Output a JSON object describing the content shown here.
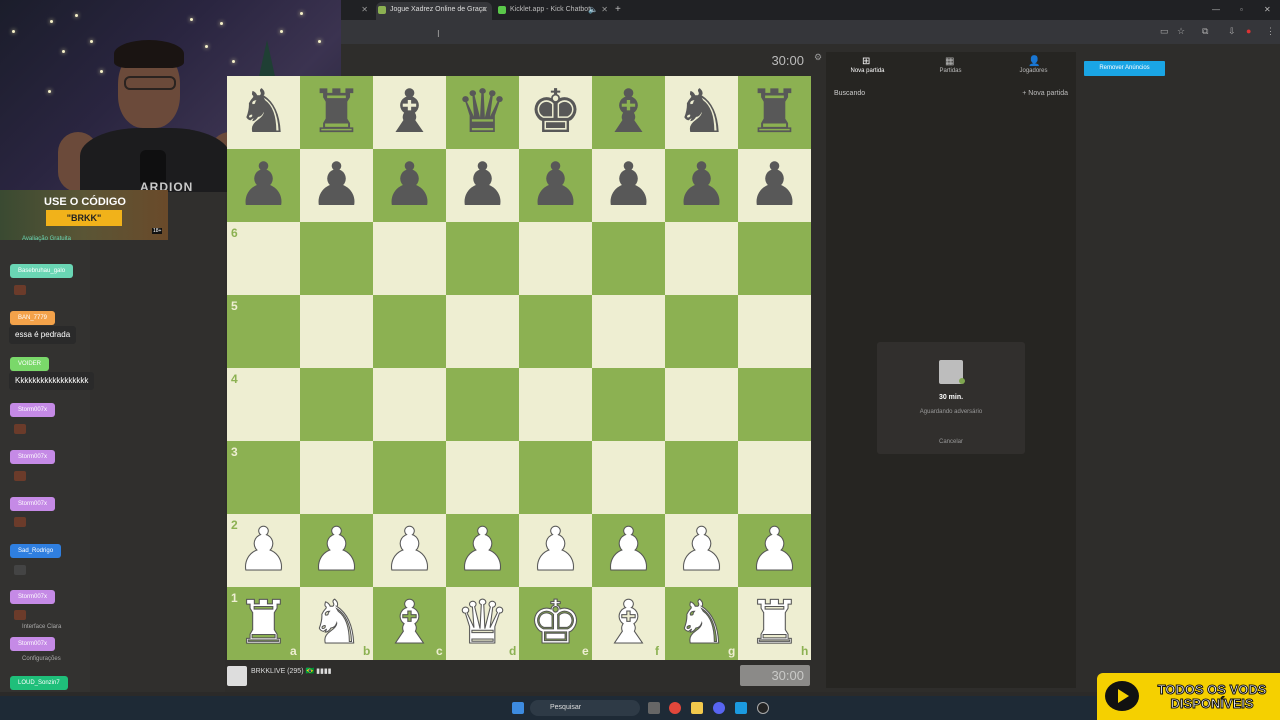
{
  "browser": {
    "tabs": [
      {
        "label": "Jogue Xadrez Online de Graça",
        "active": true
      },
      {
        "label": "Kicklet.app - Kick Chatbot",
        "active": false
      }
    ],
    "cursor_glyph": "I"
  },
  "webcam": {
    "shirt_text": "ARDION",
    "promo_line1": "USE O CÓDIGO",
    "promo_code": "\"BRKK\"",
    "promo_badge": "18+",
    "side_text": "Avaliação Gratuita"
  },
  "chat": [
    {
      "name": "Basebruhau_galo",
      "color": "#6ad6b4",
      "message": ""
    },
    {
      "name": "BAN_7779",
      "color": "#f3a24a",
      "message": "essa é pedrada"
    },
    {
      "name": "VOIDER",
      "color": "#7ad86a",
      "message": "Kkkkkkkkkkkkkkkkkk"
    },
    {
      "name": "Storm007x",
      "color": "#c58ae6",
      "message": ""
    },
    {
      "name": "Storm007x",
      "color": "#c58ae6",
      "message": ""
    },
    {
      "name": "Storm007x",
      "color": "#c58ae6",
      "message": ""
    },
    {
      "name": "Sad_Rodrigo",
      "color": "#2f7fe0",
      "message": ""
    },
    {
      "name": "Storm007x",
      "color": "#c58ae6",
      "message": ""
    },
    {
      "name": "Storm007x",
      "color": "#c58ae6",
      "message": ""
    },
    {
      "name": "LOUD_Sonzin7",
      "color": "#1fbf7a",
      "message": ""
    }
  ],
  "chat_extras": {
    "line1": "Interface Clara",
    "line2": "Configurações"
  },
  "board": {
    "ranks_labels": [
      "6",
      "5",
      "4",
      "3",
      "2",
      "1"
    ],
    "files_labels": [
      "a",
      "b",
      "c",
      "d",
      "e",
      "f",
      "g",
      "h"
    ],
    "top_rank_8": [
      "♜",
      "♝",
      "♛",
      "♚",
      "♝",
      "♞",
      "♜"
    ],
    "top_rank_7": [
      "♟",
      "♟",
      "♟",
      "♟",
      "♟",
      "♟",
      "♟",
      "♟"
    ],
    "bottom_rank_2": [
      "♟",
      "♟",
      "♟",
      "♟",
      "♟",
      "♟",
      "♟",
      "♟"
    ],
    "bottom_rank_1": [
      "♜",
      "♞",
      "♝",
      "♛",
      "♚",
      "♝",
      "♞",
      "♜"
    ],
    "colors": {
      "light": "#eeeed2",
      "dark": "#8cb152"
    }
  },
  "clocks": {
    "top": "30:00",
    "bottom": "30:00"
  },
  "player": {
    "name": "BRKKLIVE (295) 🇧🇷 ▮▮▮▮"
  },
  "right_panel": {
    "tabs": [
      {
        "label": "Nova partida",
        "icon": "plus-icon"
      },
      {
        "label": "Partidas",
        "icon": "board-icon"
      },
      {
        "label": "Jogadores",
        "icon": "players-icon"
      }
    ],
    "heading": "Buscando",
    "new_game": "+ Nova partida",
    "card_title": "30 min.",
    "card_status": "Aguardando adversário",
    "card_cancel": "Cancelar",
    "remove_ads": "Remover Anúncios"
  },
  "taskbar": {
    "search_placeholder": "Pesquisar"
  },
  "banner": {
    "line1": "TODOS OS VODS",
    "line2": "DISPONÍVEIS"
  }
}
